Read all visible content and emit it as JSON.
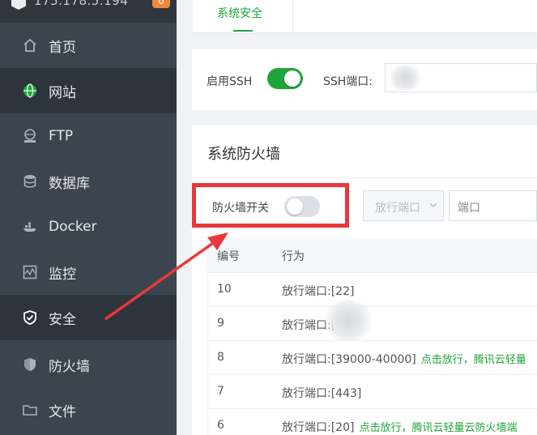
{
  "sidebar": {
    "server_ip": "175.178.5.194",
    "badge": "0",
    "items": [
      {
        "label": "首页",
        "icon": "home-icon"
      },
      {
        "label": "网站",
        "icon": "globe-icon"
      },
      {
        "label": "FTP",
        "icon": "ftp-icon"
      },
      {
        "label": "数据库",
        "icon": "database-icon"
      },
      {
        "label": "Docker",
        "icon": "docker-icon"
      },
      {
        "label": "监控",
        "icon": "monitor-icon"
      },
      {
        "label": "安全",
        "icon": "shield-check-icon"
      },
      {
        "label": "防火墙",
        "icon": "shield-icon"
      },
      {
        "label": "文件",
        "icon": "folder-icon"
      }
    ],
    "active_items": [
      "网站",
      "安全"
    ]
  },
  "tabs": [
    {
      "label": "系统安全",
      "active": true
    }
  ],
  "ssh": {
    "enable_label": "启用SSH",
    "enabled": true,
    "port_label": "SSH端口:",
    "port_value": ""
  },
  "firewall": {
    "title": "系统防火墙",
    "switch_label": "防火墙开关",
    "switch_on": false,
    "rule_type": "放行端口",
    "port_placeholder": "端口",
    "columns": [
      "编号",
      "行为"
    ],
    "rows": [
      {
        "id": "10",
        "action": "放行端口:[22]",
        "note": ""
      },
      {
        "id": "9",
        "action": "放行端口:[",
        "note": ""
      },
      {
        "id": "8",
        "action": "放行端口:[39000-40000]",
        "note": "点击放行，腾讯云轻量"
      },
      {
        "id": "7",
        "action": "放行端口:[443]",
        "note": ""
      },
      {
        "id": "6",
        "action": "放行端口:[20]",
        "note": "点击放行，腾讯云轻量云防火墙端"
      }
    ]
  },
  "colors": {
    "accent": "#20a53a",
    "sidebar_bg": "#3c444d",
    "highlight": "#e8383d"
  }
}
